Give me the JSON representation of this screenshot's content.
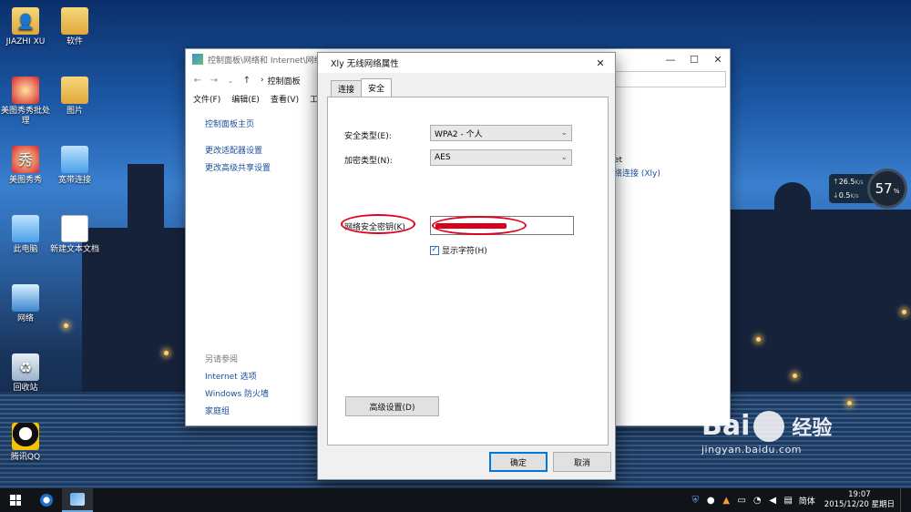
{
  "desktop": {
    "icons": [
      {
        "label": "JIAZHI XU",
        "icon": "user-folder-icon"
      },
      {
        "label": "软件",
        "icon": "folder-icon"
      },
      {
        "label": "美图秀秀批处理",
        "icon": "meitu-batch-icon"
      },
      {
        "label": "图片",
        "icon": "folder-icon"
      },
      {
        "label": "美图秀秀",
        "icon": "meitu-icon"
      },
      {
        "label": "宽带连接",
        "icon": "broadband-icon"
      },
      {
        "label": "此电脑",
        "icon": "computer-icon"
      },
      {
        "label": "新建文本文档",
        "icon": "text-document-icon"
      },
      {
        "label": "网络",
        "icon": "network-icon"
      },
      {
        "label": "回收站",
        "icon": "recycle-bin-icon"
      },
      {
        "label": "腾讯QQ",
        "icon": "qq-icon"
      }
    ]
  },
  "control_panel": {
    "title": "控制面板\\网络和 Internet\\网络和",
    "address": "控制面板",
    "menu": [
      "文件(F)",
      "编辑(E)",
      "查看(V)",
      "工"
    ],
    "left_links": [
      "控制面板主页",
      "更改适配器设置",
      "更改高级共享设置"
    ],
    "see_also_header": "另请参阅",
    "see_also": [
      "Internet 选项",
      "Windows 防火墙",
      "家庭组"
    ],
    "right_text_1": "et",
    "right_text_2": "络连接 (Xly)"
  },
  "dialog": {
    "title": "Xly 无线网络属性",
    "tabs": [
      {
        "label": "连接",
        "active": false
      },
      {
        "label": "安全",
        "active": true
      }
    ],
    "security_type_label": "安全类型(E):",
    "security_type_value": "WPA2 - 个人",
    "encryption_type_label": "加密类型(N):",
    "encryption_type_value": "AES",
    "network_key_label": "网络安全密钥(K)",
    "show_chars_label": "显示字符(H)",
    "show_chars_checked": true,
    "advanced_button": "高级设置(D)",
    "ok_button": "确定",
    "cancel_button": "取消"
  },
  "speed_widget": {
    "upload": "26.5",
    "download": "0.5",
    "unit": "K/s",
    "percent": "57",
    "percent_sign": "%"
  },
  "watermark": {
    "brand": "Bai",
    "brand_suffix": "经验",
    "url": "jingyan.baidu.com"
  },
  "taskbar": {
    "ime": "简体",
    "time": "19:07",
    "date": "2015/12/20 星期日"
  },
  "colors": {
    "annotation_red": "#e2001a",
    "accent_blue": "#0078d7",
    "taskbar": "#101418"
  }
}
